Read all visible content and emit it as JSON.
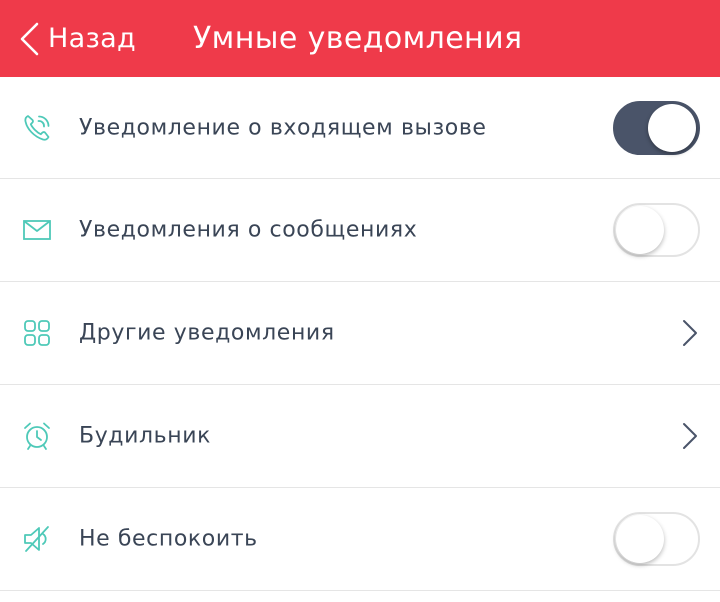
{
  "header": {
    "back_label": "Назад",
    "title": "Умные уведомления",
    "background": "#ef3a4a"
  },
  "colors": {
    "icon_teal": "#4ec9b8",
    "toggle_on": "#4a5469",
    "text": "#3a4556"
  },
  "settings": [
    {
      "label": "Уведомление о входящем вызове",
      "icon": "phone-incoming-icon",
      "control": "toggle",
      "enabled": true
    },
    {
      "label": "Уведомления о сообщениях",
      "icon": "envelope-icon",
      "control": "toggle",
      "enabled": false
    },
    {
      "label": "Другие уведомления",
      "icon": "grid-icon",
      "control": "chevron"
    },
    {
      "label": "Будильник",
      "icon": "alarm-clock-icon",
      "control": "chevron"
    },
    {
      "label": "Не беспокоить",
      "icon": "speaker-mute-icon",
      "control": "toggle",
      "enabled": false
    }
  ]
}
